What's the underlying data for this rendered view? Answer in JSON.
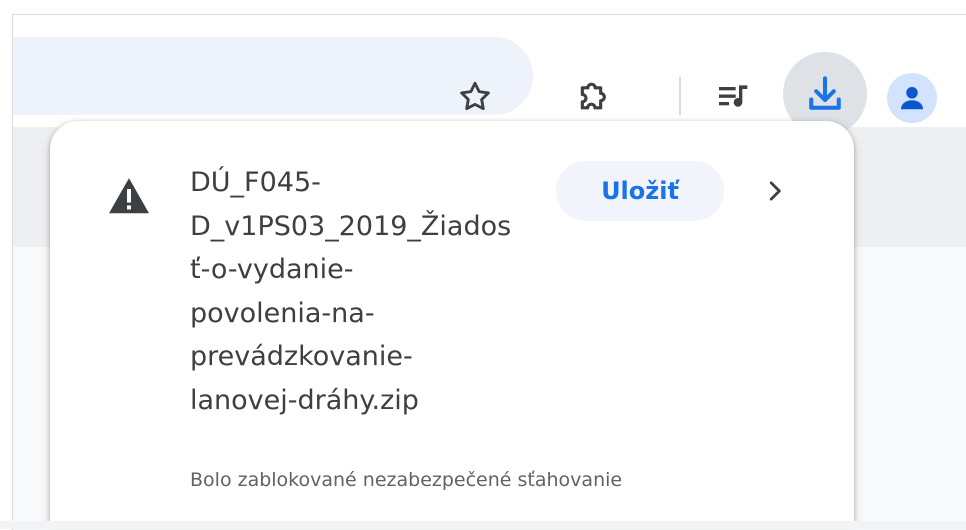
{
  "browser": {
    "toolbar": {
      "icons": {
        "bookmark": "star-icon",
        "extensions": "puzzle-piece-icon",
        "media": "playlist-icon",
        "downloads": "download-icon",
        "profile": "person-icon"
      }
    },
    "download_bubble": {
      "item": {
        "warning_icon": "warning-triangle-icon",
        "filename_lines": [
          "DÚ_F045-",
          "D_v1PS03_2019_Žiados",
          "ť-o-vydanie-",
          "povolenia-na-",
          "prevádzkovanie-",
          "lanovej-dráhy.zip"
        ],
        "status": "Bolo zablokované nezabezpečené sťahovanie",
        "save_label": "Uložiť",
        "more_icon": "chevron-right-icon"
      }
    }
  },
  "colors": {
    "accent": "#1a73e8",
    "download_button_bg": "#dee1e6",
    "avatar_bg": "#d3e3fd",
    "omnibox_bg": "#edf2fb",
    "text_primary": "#3c4043",
    "text_secondary": "#5f6368"
  }
}
